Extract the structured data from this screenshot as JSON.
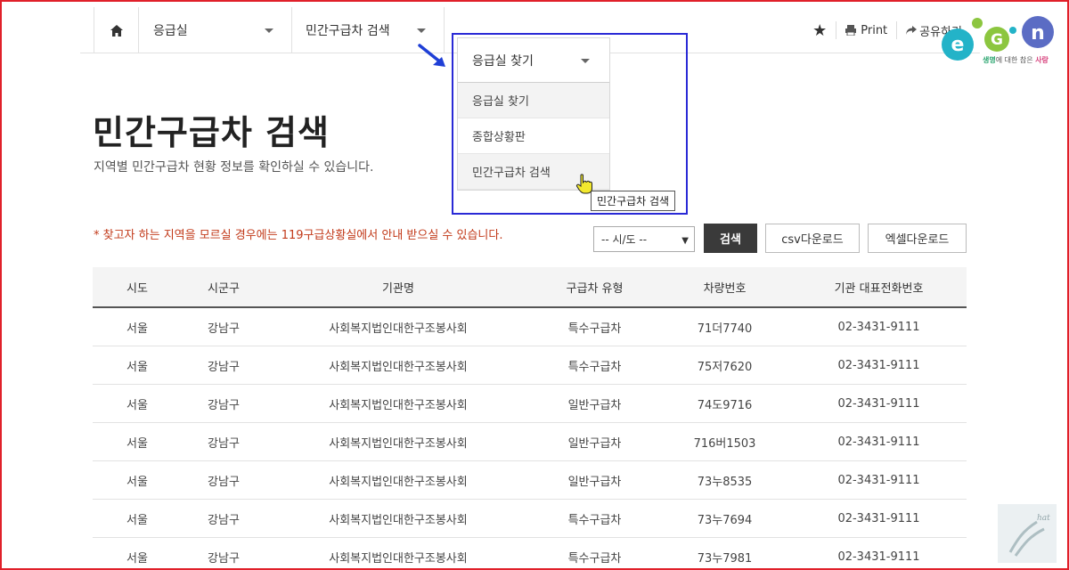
{
  "nav": {
    "level1": "응급실",
    "level2": "민간구급차 검색",
    "print": "Print",
    "share": "공유하기"
  },
  "dropdown": {
    "header": "응급실 찾기",
    "items": [
      {
        "label": "응급실 찾기"
      },
      {
        "label": "종합상황판"
      },
      {
        "label": "민간구급차 검색"
      }
    ],
    "tooltip": "민간구급차 검색"
  },
  "logo": {
    "sub_green": "생명",
    "sub_mid": "에 대한 참은 ",
    "sub_pink": "사랑"
  },
  "page": {
    "title": "민간구급차 검색",
    "description": "지역별 민간구급차 현황 정보를 확인하실 수 있습니다.",
    "notice": "* 찾고자 하는 지역을 모르실 경우에는 119구급상황실에서 안내 받으실 수 있습니다."
  },
  "controls": {
    "region_select": "-- 시/도 --",
    "search": "검색",
    "csv": "csv다운로드",
    "excel": "엑셀다운로드"
  },
  "table": {
    "headers": [
      "시도",
      "시군구",
      "기관명",
      "구급차 유형",
      "차량번호",
      "기관 대표전화번호"
    ],
    "rows": [
      [
        "서울",
        "강남구",
        "사회복지법인대한구조봉사회",
        "특수구급차",
        "71더7740",
        "02-3431-9111"
      ],
      [
        "서울",
        "강남구",
        "사회복지법인대한구조봉사회",
        "특수구급차",
        "75저7620",
        "02-3431-9111"
      ],
      [
        "서울",
        "강남구",
        "사회복지법인대한구조봉사회",
        "일반구급차",
        "74도9716",
        "02-3431-9111"
      ],
      [
        "서울",
        "강남구",
        "사회복지법인대한구조봉사회",
        "일반구급차",
        "716버1503",
        "02-3431-9111"
      ],
      [
        "서울",
        "강남구",
        "사회복지법인대한구조봉사회",
        "일반구급차",
        "73누8535",
        "02-3431-9111"
      ],
      [
        "서울",
        "강남구",
        "사회복지법인대한구조봉사회",
        "특수구급차",
        "73누7694",
        "02-3431-9111"
      ],
      [
        "서울",
        "강남구",
        "사회복지법인대한구조봉사회",
        "특수구급차",
        "73누7981",
        "02-3431-9111"
      ]
    ]
  },
  "colors": {
    "frame": "#e0202a",
    "highlight": "#2a2ad6",
    "notice": "#c23a1a",
    "search_button": "#3a3a3a"
  }
}
